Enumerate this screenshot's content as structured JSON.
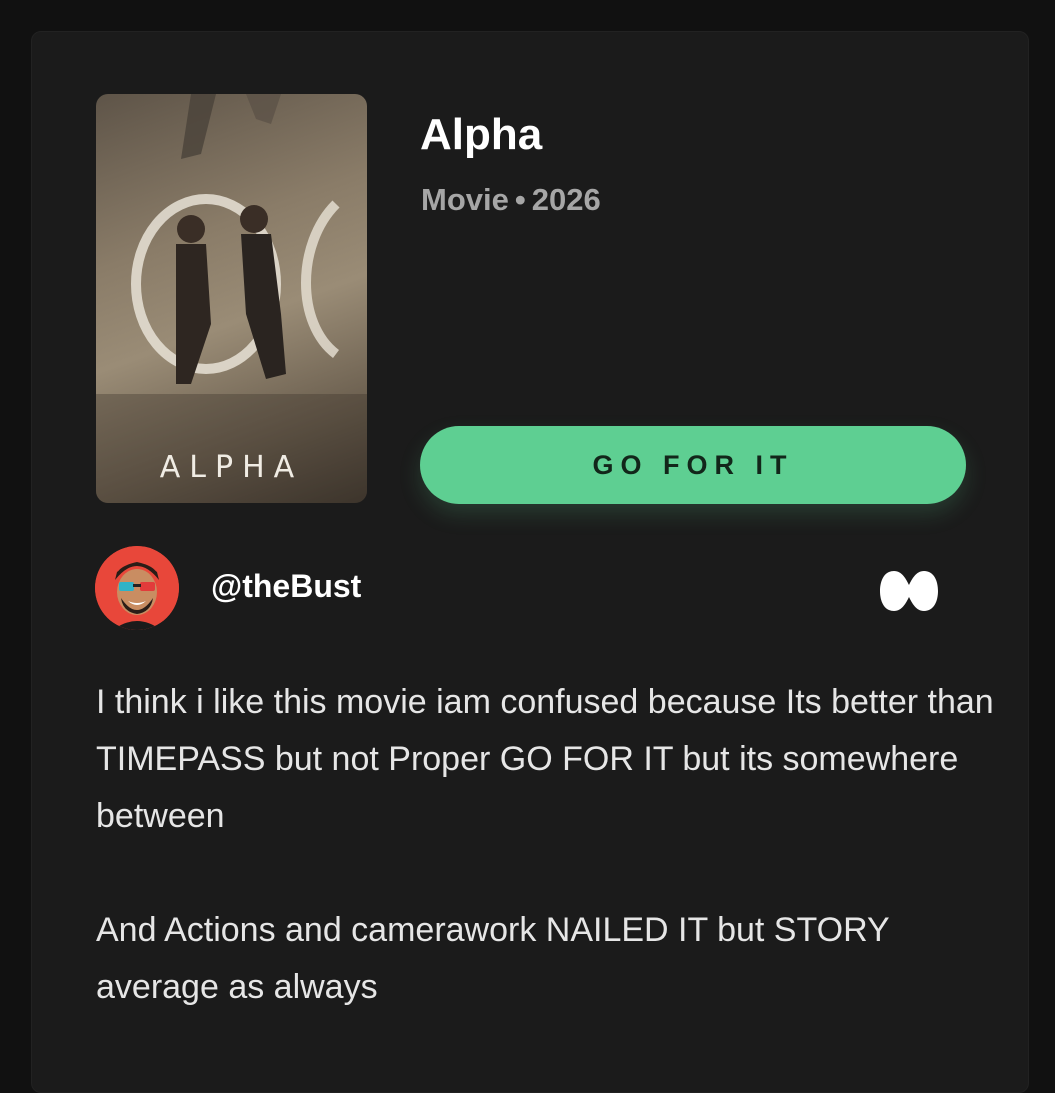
{
  "movie": {
    "title": "Alpha",
    "type": "Movie",
    "separator": "•",
    "year": "2026",
    "poster_text": "ALPHA"
  },
  "action": {
    "verdict_label": "GO FOR IT"
  },
  "review": {
    "username": "@theBust",
    "rating_icon": "alpha-infinity-icon",
    "paragraphs": [
      "I think i like this movie iam confused because Its better than TIMEPASS but not Proper GO FOR IT but its somewhere between",
      "And Actions and camerawork NAILED IT but STORY average as always"
    ]
  },
  "colors": {
    "background": "#111111",
    "card": "#1b1b1b",
    "accent": "#5ecf92",
    "muted_text": "#a6a6a6",
    "avatar_bg": "#e8473a"
  }
}
